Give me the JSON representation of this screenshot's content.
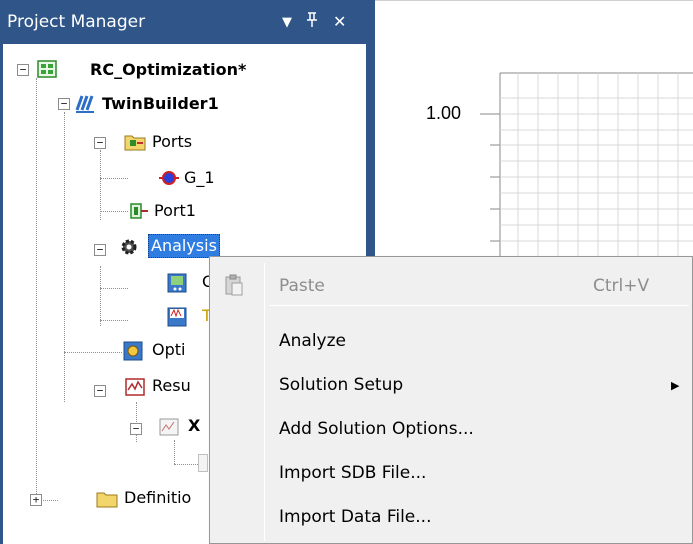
{
  "panel": {
    "title": "Project Manager",
    "pin_symbol": "▼",
    "dock_symbol": "ꟸ",
    "close_symbol": "✕"
  },
  "tree": {
    "root": "RC_Optimization*",
    "design": "TwinBuilder1",
    "ports": "Ports",
    "port_g1": "G_1",
    "port1": "Port1",
    "analysis": "Analysis",
    "child_c": "C",
    "child_t": "T",
    "optimetrics": "Opti",
    "results": "Resu",
    "report": "X",
    "definitions": "Definitio"
  },
  "chart": {
    "y_tick_label": "1.00"
  },
  "context_menu": {
    "paste": "Paste",
    "paste_shortcut": "Ctrl+V",
    "analyze": "Analyze",
    "solution_setup": "Solution Setup",
    "submenu_arrow": "▶",
    "add_solution_options": "Add Solution Options...",
    "import_sdb": "Import SDB File...",
    "import_data": "Import Data File..."
  },
  "colors": {
    "title_bar": "#2f5589",
    "selection": "#2f7de1",
    "menu_bg": "#f0f0f0",
    "disabled_text": "#8d8d8d"
  }
}
